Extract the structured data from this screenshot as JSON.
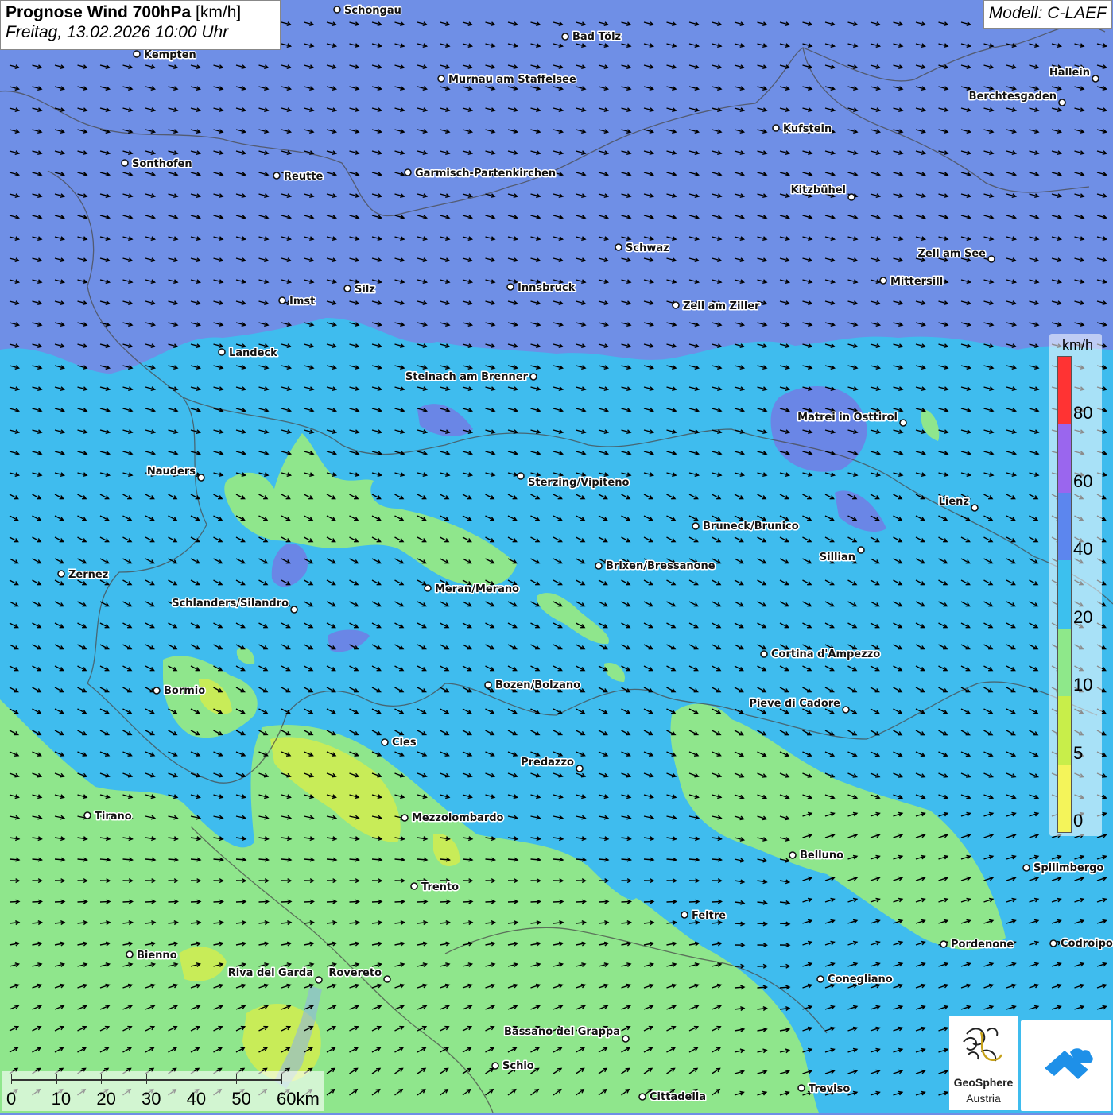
{
  "header": {
    "title_bold": "Prognose Wind 700hPa",
    "title_unit": " [km/h]",
    "datetime": "Freitag, 13.02.2026 10:00 Uhr",
    "model": "Modell: C-LAEF"
  },
  "legend": {
    "unit": "km/h",
    "classes": [
      {
        "label": "0",
        "color": "#f4f45a"
      },
      {
        "label": "5",
        "color": "#c8ee4a"
      },
      {
        "label": "10",
        "color": "#8ee88a"
      },
      {
        "label": "20",
        "color": "#3cc0ee"
      },
      {
        "label": "40",
        "color": "#5c86ee"
      },
      {
        "label": "60",
        "color": "#9a66ee"
      },
      {
        "label": "80",
        "color": "#ff3333"
      }
    ]
  },
  "scale_bar": {
    "labels": [
      "0",
      "10",
      "20",
      "30",
      "40",
      "50",
      "60km"
    ]
  },
  "logos": {
    "geosphere_line1": "GeoSphere",
    "geosphere_line2": "Austria"
  },
  "wind": {
    "arrow_color": "#000000",
    "direction_north_zone": "east-southeast",
    "direction_south_zone": "northeast"
  },
  "cities": [
    {
      "name": "Schongau"
    },
    {
      "name": "Bad Tölz"
    },
    {
      "name": "Kempten"
    },
    {
      "name": "Murnau am Staffelsee"
    },
    {
      "name": "Hallein"
    },
    {
      "name": "Berchtesgaden"
    },
    {
      "name": "Kufstein"
    },
    {
      "name": "Sonthofen"
    },
    {
      "name": "Reutte"
    },
    {
      "name": "Garmisch-Partenkirchen"
    },
    {
      "name": "Kitzbühel"
    },
    {
      "name": "Schwaz"
    },
    {
      "name": "Zell am See"
    },
    {
      "name": "Mittersill"
    },
    {
      "name": "Silz"
    },
    {
      "name": "Innsbruck"
    },
    {
      "name": "Imst"
    },
    {
      "name": "Zell am Ziller"
    },
    {
      "name": "Landeck"
    },
    {
      "name": "Steinach am Brenner"
    },
    {
      "name": "Matrei in Osttirol"
    },
    {
      "name": "Nauders"
    },
    {
      "name": "Sterzing/Vipiteno"
    },
    {
      "name": "Lienz"
    },
    {
      "name": "Bruneck/Brunico"
    },
    {
      "name": "Sillian"
    },
    {
      "name": "Brixen/Bressanone"
    },
    {
      "name": "Zernez"
    },
    {
      "name": "Meran/Merano"
    },
    {
      "name": "Schlanders/Silandro"
    },
    {
      "name": "Cortina d'Ampezzo"
    },
    {
      "name": "Bozen/Bolzano"
    },
    {
      "name": "Bormio"
    },
    {
      "name": "Pieve di Cadore"
    },
    {
      "name": "Cles"
    },
    {
      "name": "Predazzo"
    },
    {
      "name": "Tirano"
    },
    {
      "name": "Mezzolombardo"
    },
    {
      "name": "Belluno"
    },
    {
      "name": "Spilimbergo"
    },
    {
      "name": "Trento"
    },
    {
      "name": "Feltre"
    },
    {
      "name": "Pordenone"
    },
    {
      "name": "Codroipo"
    },
    {
      "name": "Bienno"
    },
    {
      "name": "Riva del Garda"
    },
    {
      "name": "Rovereto"
    },
    {
      "name": "Conegliano"
    },
    {
      "name": "Bassano del Grappa"
    },
    {
      "name": "Schio"
    },
    {
      "name": "Treviso"
    },
    {
      "name": "Cittadella"
    }
  ]
}
